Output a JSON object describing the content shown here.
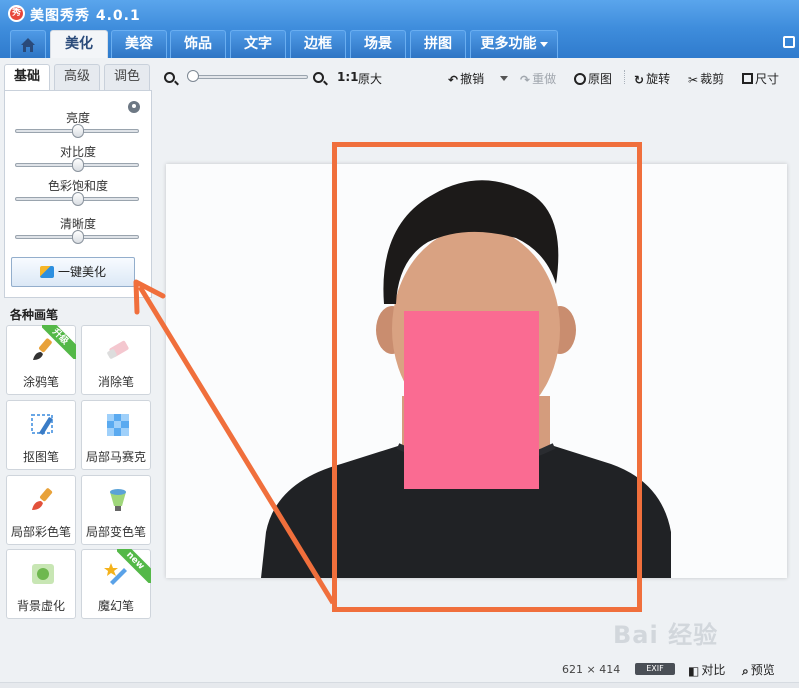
{
  "app": {
    "title": "美图秀秀 4.0.1",
    "logo_text": "秀"
  },
  "nav": {
    "tabs": [
      "美化",
      "美容",
      "饰品",
      "文字",
      "边框",
      "场景",
      "拼图"
    ],
    "more_label": "更多功能",
    "active_tab": "美化"
  },
  "panel": {
    "subtabs": [
      "基础",
      "高级",
      "调色"
    ],
    "active_subtab": "基础",
    "sliders": [
      {
        "label": "亮度",
        "value": 0.5
      },
      {
        "label": "对比度",
        "value": 0.5
      },
      {
        "label": "色彩饱和度",
        "value": 0.5
      },
      {
        "label": "清晰度",
        "value": 0.5
      }
    ],
    "one_key_label": "一键美化",
    "brushes_title": "各种画笔",
    "tools": [
      {
        "label": "涂鸦笔",
        "badge": "升级",
        "icon": "paintbrush-icon"
      },
      {
        "label": "消除笔",
        "badge": "",
        "icon": "eraser-icon"
      },
      {
        "label": "抠图笔",
        "badge": "",
        "icon": "cutout-pen-icon"
      },
      {
        "label": "局部马赛克",
        "badge": "",
        "icon": "mosaic-icon"
      },
      {
        "label": "局部彩色笔",
        "badge": "",
        "icon": "color-brush-icon"
      },
      {
        "label": "局部变色笔",
        "badge": "",
        "icon": "color-change-icon"
      },
      {
        "label": "背景虚化",
        "badge": "",
        "icon": "blur-icon"
      },
      {
        "label": "魔幻笔",
        "badge": "new",
        "icon": "magic-pen-icon"
      }
    ]
  },
  "toolbar": {
    "zoom_ratio": "1:1",
    "original_size": "原大",
    "zoom_level": 0,
    "undo": "撤销",
    "redo": "重做",
    "original": "原图",
    "rotate": "旋转",
    "crop": "裁剪",
    "resize": "尺寸"
  },
  "status": {
    "width": "621",
    "times": "×",
    "height": "414",
    "exif": "EXIF",
    "compare": "对比",
    "preview": "预览"
  },
  "watermark": "Bai 经验",
  "colors": {
    "title_blue": "#3f8ddc",
    "annotation_orange": "#f06f3c",
    "mosaic_pink": "#fa6b92",
    "badge_green": "#54b848"
  }
}
